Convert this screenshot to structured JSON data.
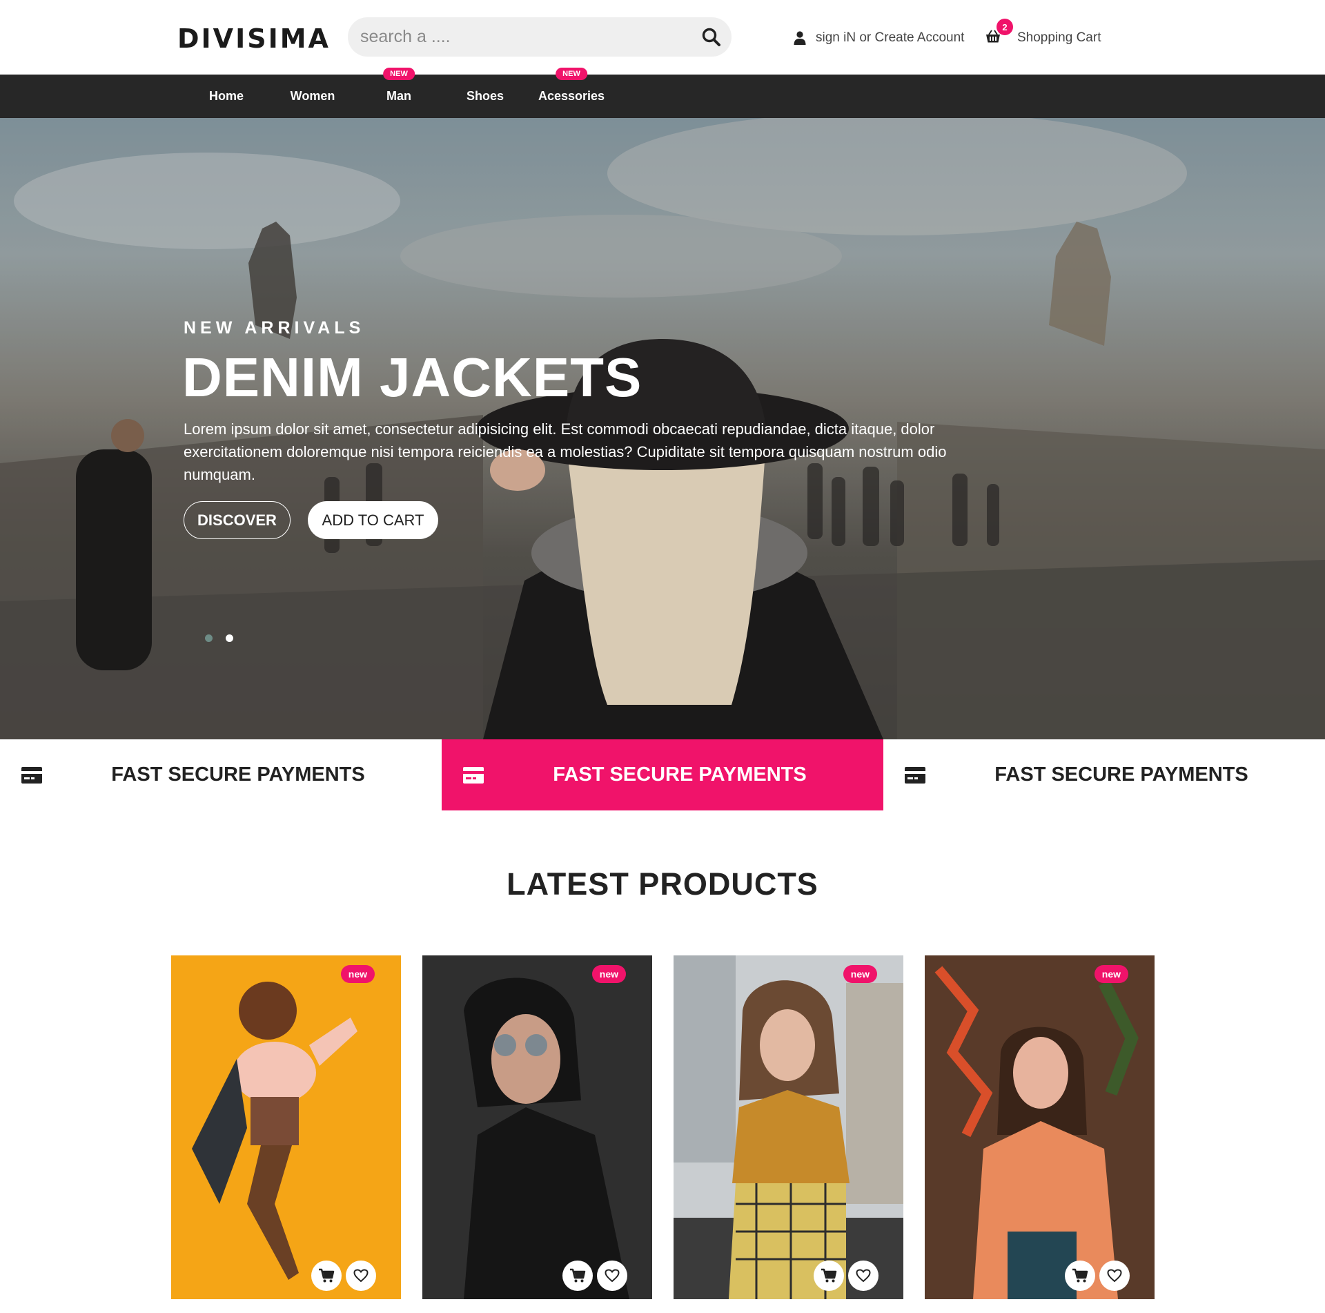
{
  "header": {
    "logo": "DIVISIMA",
    "search_placeholder": "search a ....",
    "account_label": "sign iN or Create Account",
    "cart_label": "Shopping Cart",
    "cart_count": "2"
  },
  "nav": {
    "items": [
      {
        "label": "Home",
        "badge": ""
      },
      {
        "label": "Women",
        "badge": ""
      },
      {
        "label": "Man",
        "badge": "NEW"
      },
      {
        "label": "Shoes",
        "badge": ""
      },
      {
        "label": "Acessories",
        "badge": "NEW"
      }
    ]
  },
  "hero": {
    "kicker": "NEW ARRIVALS",
    "title": "DENIM JACKETS",
    "text": "Lorem ipsum dolor sit amet, consectetur adipisicing elit. Est commodi obcaecati repudiandae, dicta itaque, dolor exercitationem doloremque nisi tempora reiciendis ea a molestias? Cupiditate sit tempora quisquam nostrum odio numquam.",
    "discover_label": "DISCOVER",
    "add_to_cart_label": "ADD TO CART",
    "slide_count": 2,
    "active_slide": 2
  },
  "features": [
    {
      "label": "FAST SECURE PAYMENTS",
      "icon": "credit-card-icon",
      "highlighted": false
    },
    {
      "label": "FAST SECURE PAYMENTS",
      "icon": "credit-card-icon",
      "highlighted": true
    },
    {
      "label": "FAST SECURE PAYMENTS",
      "icon": "credit-card-icon",
      "highlighted": false
    }
  ],
  "latest": {
    "title": "LATEST PRODUCTS",
    "products": [
      {
        "badge": "new",
        "bg": "#f5a516"
      },
      {
        "badge": "new",
        "bg": "#2f2f2f"
      },
      {
        "badge": "new",
        "bg": "#c9cdd0"
      },
      {
        "badge": "new",
        "bg": "#8e3a2c"
      }
    ]
  },
  "colors": {
    "accent": "#f0136a",
    "nav_bg": "#272727"
  }
}
